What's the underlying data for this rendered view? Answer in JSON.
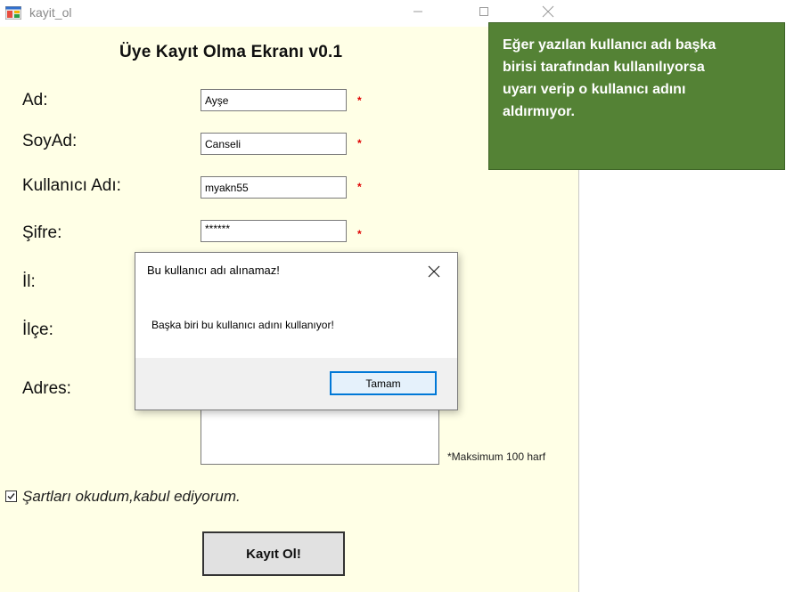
{
  "window": {
    "title": "kayit_ol"
  },
  "form": {
    "title": "Üye Kayıt Olma Ekranı v0.1",
    "required_marker": "*",
    "fields": [
      {
        "label": "Ad:",
        "value": "Ayşe"
      },
      {
        "label": "SoyAd:",
        "value": "Canseli"
      },
      {
        "label": "Kullanıcı Adı:",
        "value": "myakn55"
      },
      {
        "label": "Şifre:",
        "value": "******"
      },
      {
        "label": "İl:"
      },
      {
        "label": "İlçe:"
      },
      {
        "label": "Adres:"
      }
    ],
    "address_note": "*Maksimum 100 harf",
    "terms_checked": true,
    "terms_label": "Şartları okudum,kabul ediyorum.",
    "submit_label": "Kayıt Ol!"
  },
  "message_box": {
    "title": "Bu kullanıcı adı alınamaz!",
    "text": "Başka biri bu kullanıcı adını kullanıyor!",
    "ok_label": "Tamam"
  },
  "callout": {
    "text": "Eğer yazılan kullanıcı adı başka\nbirisi tarafından kullanılıyorsa\nuyarı verip  o kullanıcı adını\naldırmıyor."
  },
  "colors": {
    "form_background": "#ffffe6",
    "callout_background": "#548235",
    "required_marker": "#e00000",
    "dialog_button_border": "#0078d7"
  }
}
